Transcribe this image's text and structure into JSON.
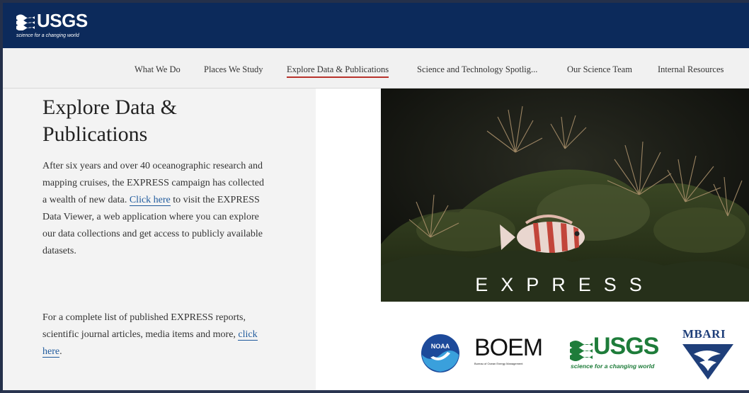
{
  "header": {
    "logo_text": "USGS",
    "logo_tagline": "science for a changing world"
  },
  "nav": {
    "items": [
      {
        "label": "What We Do",
        "active": false
      },
      {
        "label": "Places We Study",
        "active": false
      },
      {
        "label": "Explore Data & Publications",
        "active": true
      },
      {
        "label": "Science and Technology Spotlig...",
        "active": false
      },
      {
        "label": "Our Science Team",
        "active": false
      },
      {
        "label": "Internal Resources",
        "active": false
      }
    ]
  },
  "main": {
    "title": "Explore Data & Publications",
    "para1": {
      "before": "After six years and over 40 oceanographic research and mapping cruises, the EXPRESS campaign has collected a wealth of new data. ",
      "link": "Click here",
      "after": " to visit the EXPRESS Data Viewer, a web application where you can explore our data collections and get access to publicly available datasets."
    },
    "para2": {
      "before": "For a complete list of published EXPRESS reports, scientific journal articles, media items and more, ",
      "link": "click here",
      "after": "."
    },
    "photo_caption": "EXPRESS"
  },
  "partners": {
    "noaa": "NOAA",
    "boem": "BOEM",
    "boem_sub": "Bureau of Ocean Energy Management",
    "usgs": "USGS",
    "usgs_tagline": "science for a changing world",
    "mbari": "MBARI"
  },
  "colors": {
    "header_bg": "#0c2a5b",
    "nav_bg": "#f1f1f1",
    "active_underline": "#b8322b",
    "link": "#1f5a9c",
    "usgs_green": "#1e7c3a"
  }
}
